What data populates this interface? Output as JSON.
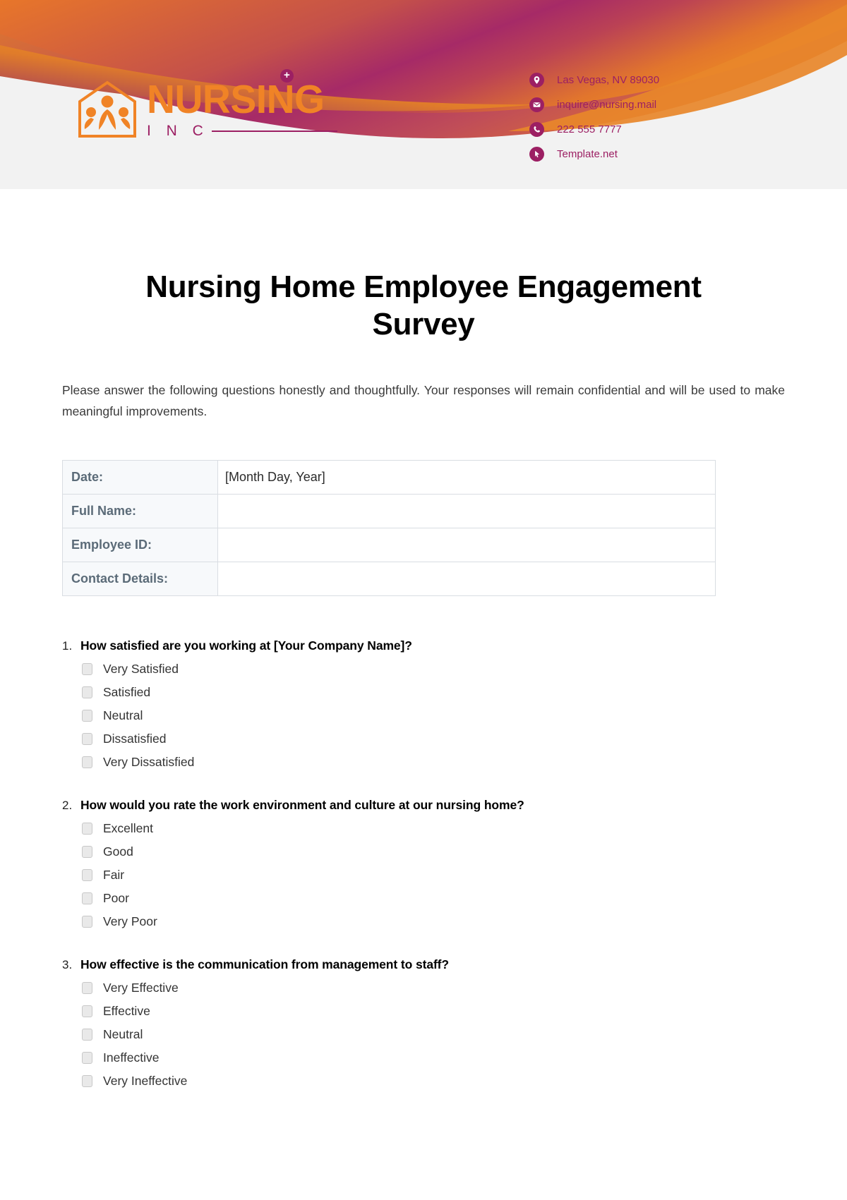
{
  "brand": {
    "name": "NURSING",
    "sub": "I N C",
    "plus_icon": "medical-cross-icon",
    "colors": {
      "orange": "#f08326",
      "magenta": "#9c1f63",
      "header_bg": "#f2f2f2"
    }
  },
  "contact": {
    "items": [
      {
        "icon": "location-pin-icon",
        "text": "Las Vegas, NV 89030"
      },
      {
        "icon": "envelope-icon",
        "text": "inquire@nursing.mail"
      },
      {
        "icon": "phone-icon",
        "text": "222 555 7777"
      },
      {
        "icon": "cursor-pointer-icon",
        "text": "Template.net"
      }
    ]
  },
  "document": {
    "title": "Nursing Home Employee Engagement Survey",
    "intro": "Please answer the following questions honestly and thoughtfully. Your responses will remain confidential and will be used to make meaningful improvements."
  },
  "info_table": {
    "rows": [
      {
        "label": "Date:",
        "value": "[Month Day, Year]"
      },
      {
        "label": "Full Name:",
        "value": ""
      },
      {
        "label": "Employee ID:",
        "value": ""
      },
      {
        "label": "Contact Details:",
        "value": ""
      }
    ]
  },
  "questions": [
    {
      "number": "1.",
      "text": "How satisfied are you working at [Your Company Name]?",
      "options": [
        "Very Satisfied",
        "Satisfied",
        "Neutral",
        "Dissatisfied",
        "Very Dissatisfied"
      ]
    },
    {
      "number": "2.",
      "text": "How would you rate the work environment and culture at our nursing home?",
      "options": [
        "Excellent",
        "Good",
        "Fair",
        "Poor",
        "Very Poor"
      ]
    },
    {
      "number": "3.",
      "text": "How effective is the communication from management to staff?",
      "options": [
        "Very Effective",
        "Effective",
        "Neutral",
        "Ineffective",
        "Very Ineffective"
      ]
    }
  ]
}
